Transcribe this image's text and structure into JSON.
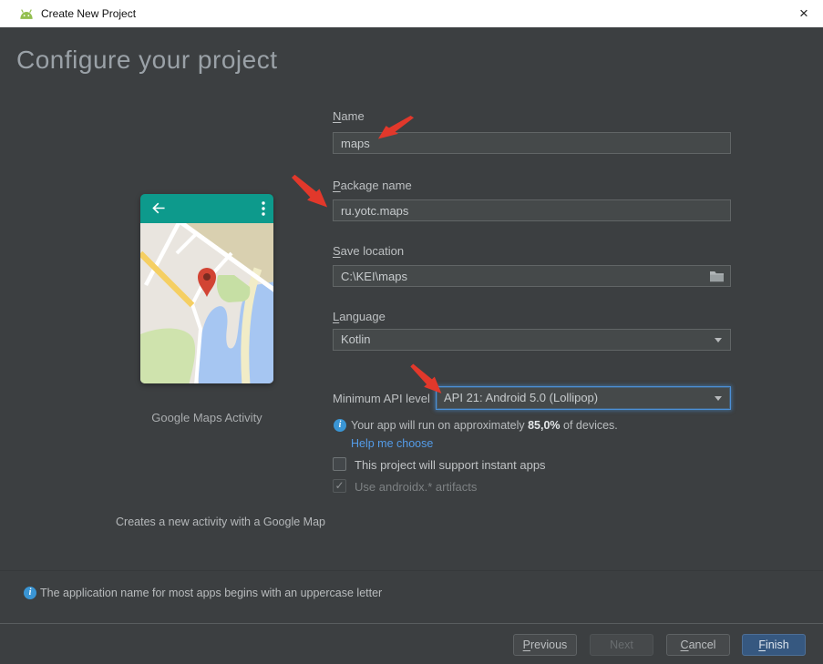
{
  "window": {
    "title": "Create New Project",
    "close_glyph": "×"
  },
  "header": {
    "title": "Configure your project"
  },
  "preview": {
    "appbar": {
      "back_glyph": "←",
      "menu_glyph": "⋮"
    },
    "template_name": "Google Maps Activity",
    "description": "Creates a new activity with a Google Map"
  },
  "form": {
    "name": {
      "mnemonic": "N",
      "label_rest": "ame",
      "value": "maps"
    },
    "package_name": {
      "mnemonic": "P",
      "label_rest": "ackage name",
      "value": "ru.yotc.maps"
    },
    "save_location": {
      "mnemonic": "S",
      "label_rest": "ave location",
      "value": "C:\\KEI\\maps"
    },
    "language": {
      "mnemonic": "L",
      "label_rest": "anguage",
      "value": "Kotlin"
    },
    "min_api": {
      "label": "Minimum API level",
      "value": "API 21: Android 5.0 (Lollipop)"
    },
    "api_info": {
      "prefix": "Your app will run on approximately ",
      "highlight": "85,0%",
      "suffix": " of devices."
    },
    "help_link": "Help me choose",
    "instant_apps": {
      "label": "This project will support instant apps",
      "checked": false,
      "check_glyph": ""
    },
    "androidx": {
      "label": "Use androidx.* artifacts",
      "checked": true,
      "check_glyph": "✓"
    }
  },
  "status_bar": {
    "message": "The application name for most apps begins with an uppercase letter"
  },
  "buttons": {
    "previous": {
      "mnemonic": "P",
      "rest": "revious"
    },
    "next": {
      "label": "Next"
    },
    "cancel": {
      "mnemonic": "C",
      "rest": "ancel"
    },
    "finish": {
      "mnemonic": "F",
      "rest": "inish"
    }
  },
  "icons": {
    "info_glyph": "i"
  },
  "colors": {
    "accent_focus": "#4c8fd6",
    "link": "#549ce8",
    "finish_bg": "#365880",
    "teal_appbar": "#0d9a8c",
    "arrow_red": "#e2382b",
    "info_blue": "#3a95d4",
    "panel_bg": "#3c3f41",
    "titlebar_bg": "#ffffff"
  }
}
